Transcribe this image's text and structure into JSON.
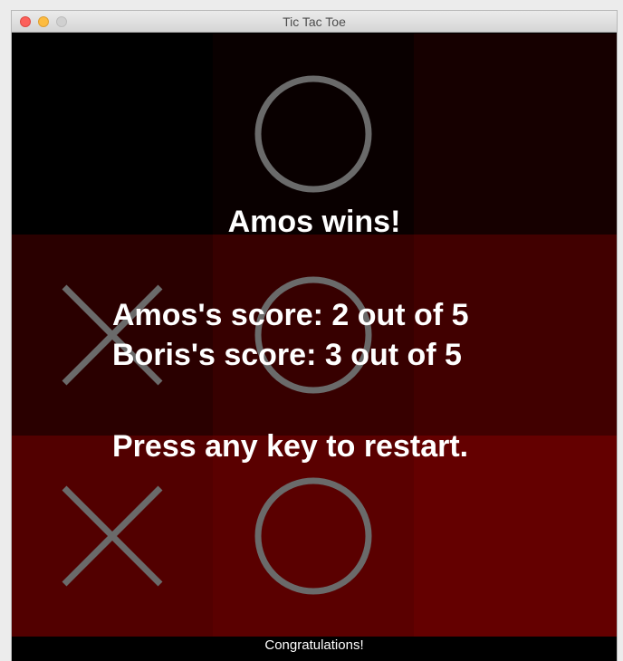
{
  "window": {
    "title": "Tic Tac Toe"
  },
  "board": {
    "cells": [
      {
        "mark": "",
        "color": "#000000"
      },
      {
        "mark": "O",
        "color": "#090000"
      },
      {
        "mark": "",
        "color": "#160000"
      },
      {
        "mark": "X",
        "color": "#2a0000"
      },
      {
        "mark": "O",
        "color": "#370000"
      },
      {
        "mark": "",
        "color": "#410000"
      },
      {
        "mark": "X",
        "color": "#520000"
      },
      {
        "mark": "O",
        "color": "#5a0000"
      },
      {
        "mark": "",
        "color": "#640000"
      }
    ],
    "mark_color": "#6a6a6a"
  },
  "overlay": {
    "winner": "Amos wins!",
    "score_1": "Amos's score: 2 out of 5",
    "score_2": "Boris's score: 3 out of 5",
    "restart": "Press any key to restart."
  },
  "status_bar": {
    "message": "Congratulations!"
  }
}
